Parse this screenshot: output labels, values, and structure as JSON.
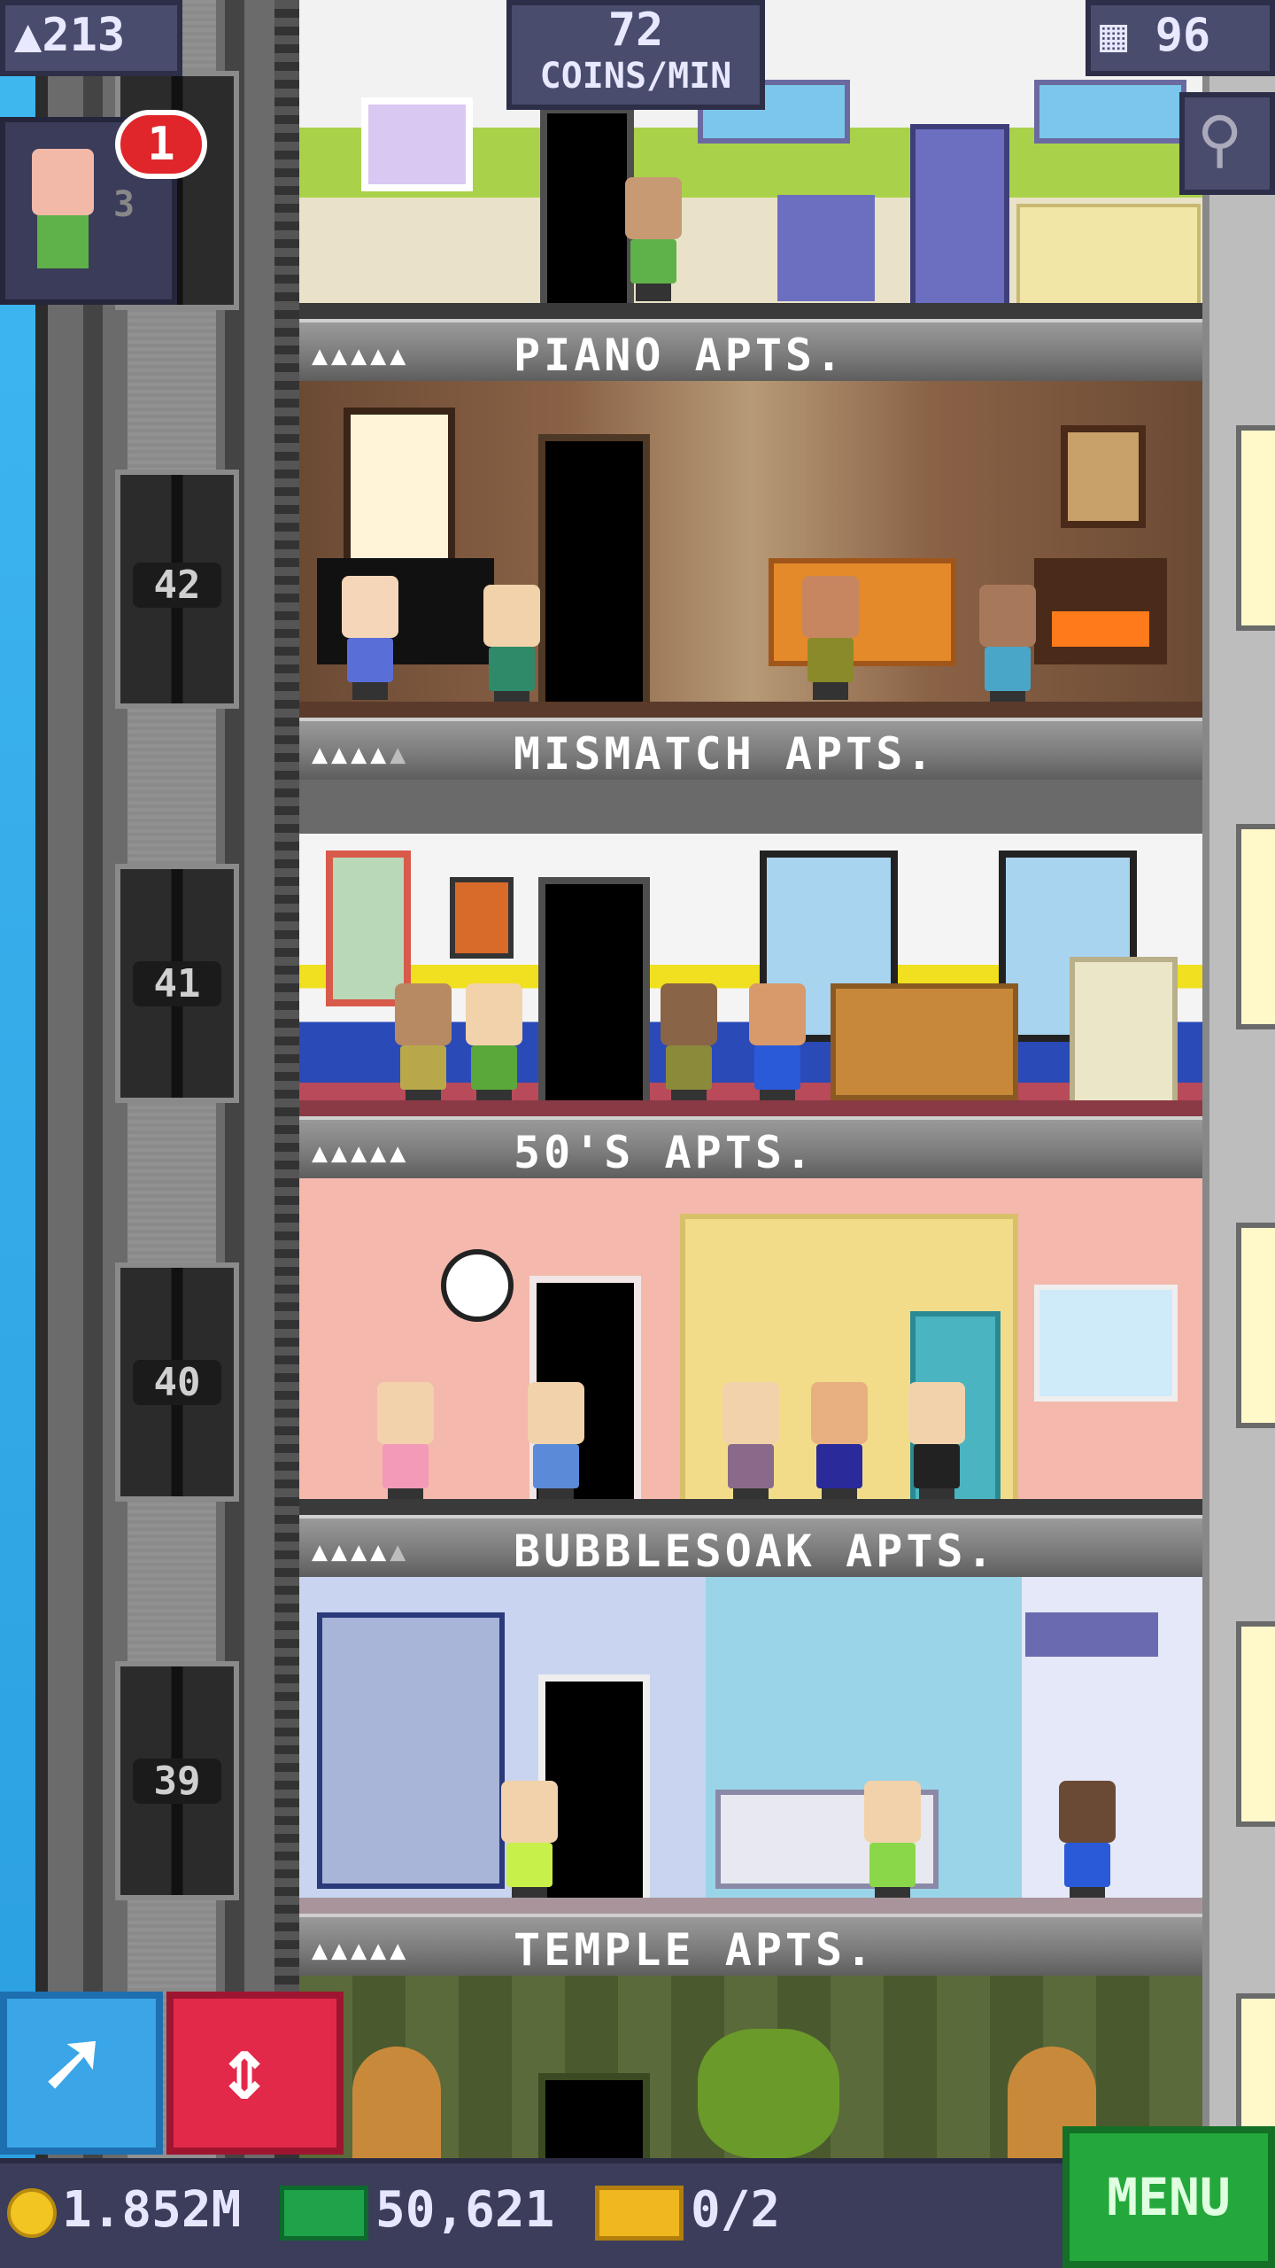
{
  "hud": {
    "population": "213",
    "coins_rate_value": "72",
    "coins_rate_unit": "COINS/MIN",
    "floor_count": "96",
    "notification_count": "1",
    "partial_floor_digit": "3"
  },
  "elevator": {
    "floor_numbers": [
      "42",
      "41",
      "40",
      "39"
    ]
  },
  "floors": [
    {
      "name": "PIANO APTS.",
      "occupancy": 5,
      "capacity": 5
    },
    {
      "name": "MISMATCH APTS.",
      "occupancy": 4,
      "capacity": 5
    },
    {
      "name": "50'S APTS.",
      "occupancy": 5,
      "capacity": 5
    },
    {
      "name": "BUBBLESOAK APTS.",
      "occupancy": 4,
      "capacity": 5
    },
    {
      "name": "TEMPLE APTS.",
      "occupancy": 5,
      "capacity": 5
    }
  ],
  "bottom": {
    "coins": "1.852M",
    "tower_bux": "50,621",
    "tickets": "0/2",
    "menu_label": "MENU"
  },
  "icons": {
    "population": "person-icon",
    "floors": "building-icon",
    "search": "magnifier-icon",
    "blue_button": "arrow-icon",
    "red_button": "up-down-arrows-icon",
    "coin": "coin-icon",
    "bux": "tower-bux-icon",
    "tickets": "ticket-icon"
  },
  "colors": {
    "menu": "#24a83c",
    "red_button": "#e3294a",
    "blue_button": "#3aa6e8",
    "hud": "#4a4c6e"
  }
}
